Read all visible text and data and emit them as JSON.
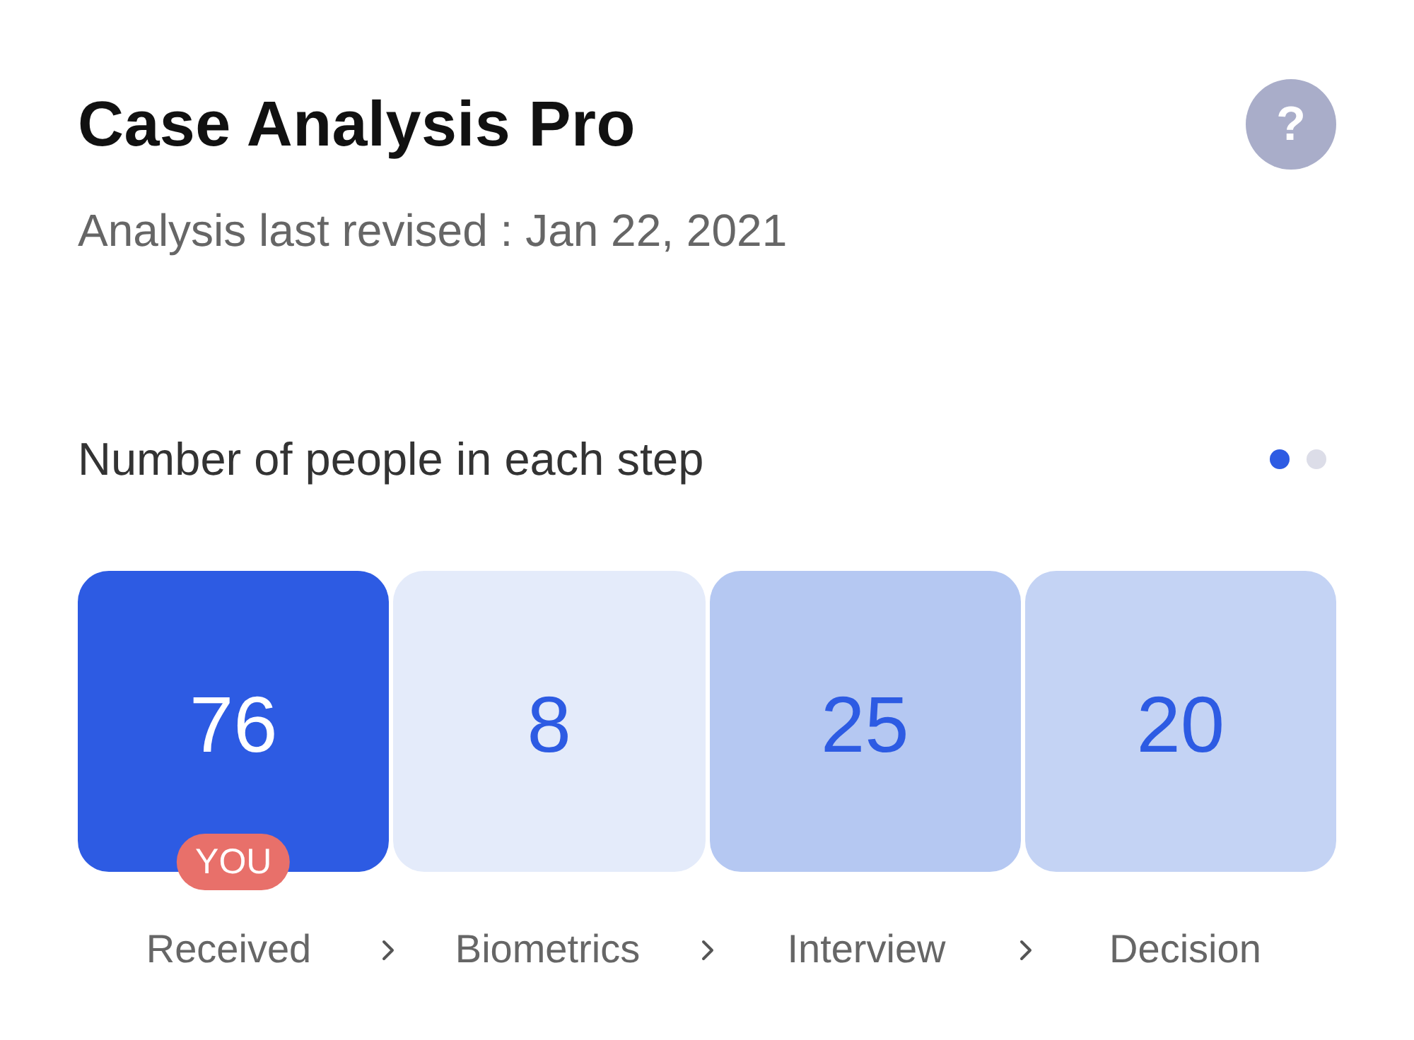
{
  "header": {
    "title": "Case Analysis Pro",
    "help_button": {
      "label": "?"
    }
  },
  "subtitle": "Analysis last revised : Jan 22, 2021",
  "section": {
    "heading": "Number of people in each step",
    "pager": [
      {
        "selected": true
      },
      {
        "selected": false
      }
    ],
    "steps": [
      {
        "count": "76",
        "label": "Received",
        "color": "#2d5be3",
        "selected": true,
        "badge": "YOU"
      },
      {
        "count": "8",
        "label": "Biometrics",
        "color": "#e4ebfa",
        "selected": false
      },
      {
        "count": "25",
        "label": "Interview",
        "color": "#b5c8f2",
        "selected": false
      },
      {
        "count": "20",
        "label": "Decision",
        "color": "#c4d3f4",
        "selected": false
      }
    ]
  }
}
